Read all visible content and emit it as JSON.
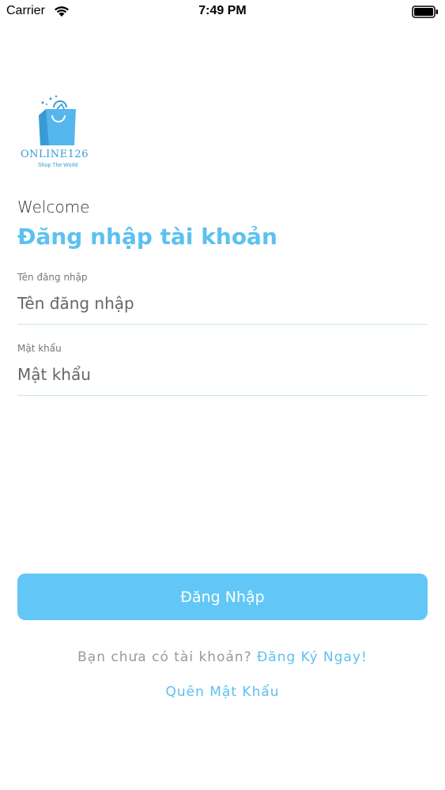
{
  "status_bar": {
    "carrier": "Carrier",
    "time": "7:49 PM",
    "icons": [
      "wifi-icon",
      "battery-icon"
    ]
  },
  "logo": {
    "name": "ONLINE126",
    "tagline": "Shop The World",
    "icon": "shopping-bag-icon",
    "color": "#3a9ad6"
  },
  "header": {
    "welcome": "Welcome",
    "title": "Đăng nhập tài khoản"
  },
  "form": {
    "username": {
      "label": "Tên đăng nhập",
      "placeholder": "Tên đăng nhập",
      "value": ""
    },
    "password": {
      "label": "Mật khẩu",
      "placeholder": "Mật khẩu",
      "value": ""
    },
    "login_label": "Đăng Nhập"
  },
  "footer": {
    "signup_prompt": "Bạn chưa có tài khoản?",
    "signup_link": "Đăng Ký Ngay!",
    "forgot_link": "Quên Mật Khẩu"
  },
  "colors": {
    "accent": "#5cc1f0",
    "button": "#62c7f6",
    "divider": "#c9e6f4"
  }
}
